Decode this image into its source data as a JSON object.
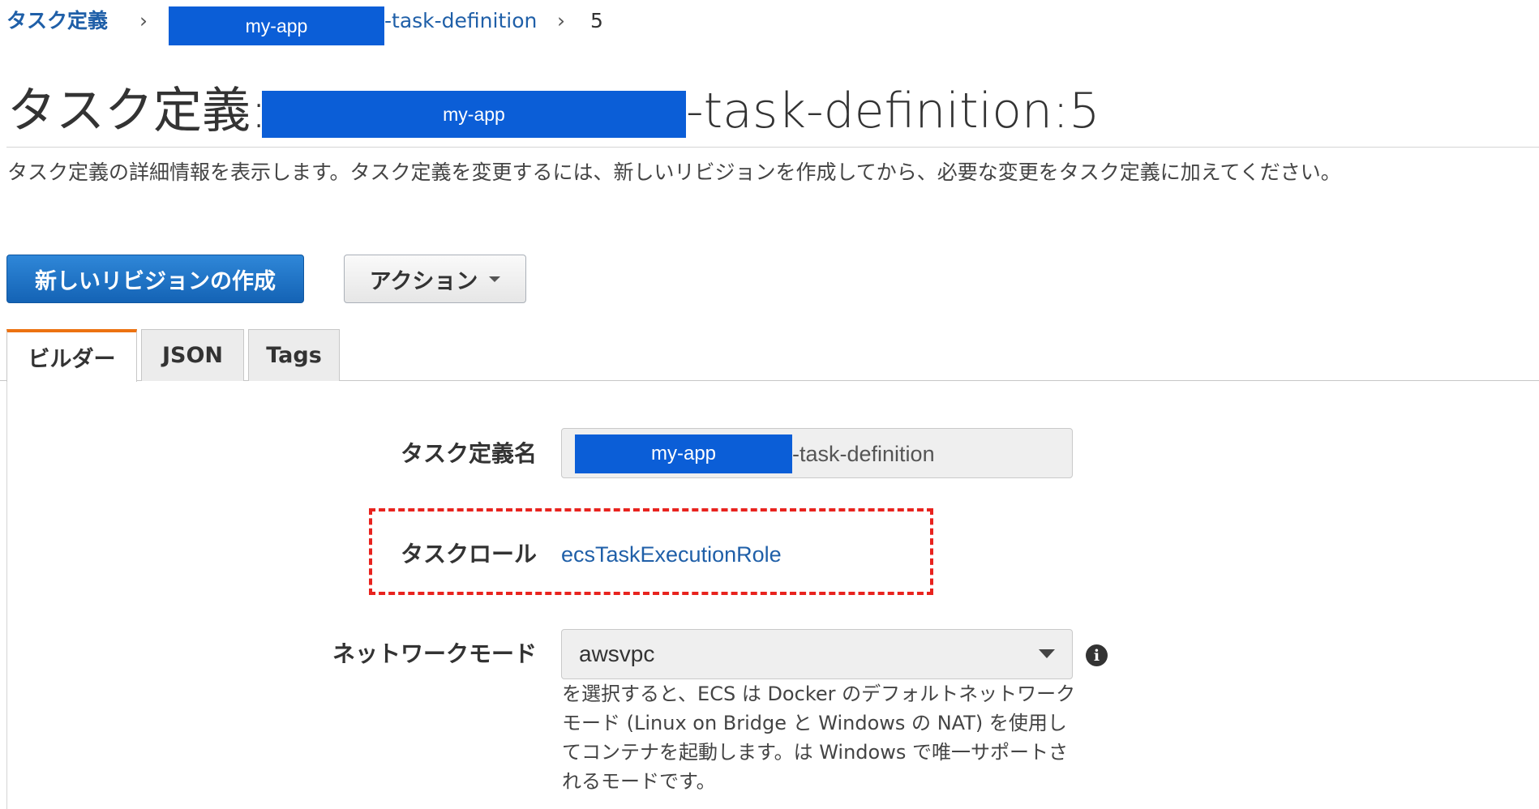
{
  "breadcrumb": {
    "root": "タスク定義",
    "redacted_name": "my-app",
    "definition_suffix": "-task-definition",
    "revision": "5",
    "separator": "›"
  },
  "title": {
    "prefix": "タスク定義: ",
    "redacted_name": "my-app",
    "suffix": "-task-definition:5"
  },
  "description": "タスク定義の詳細情報を表示します。タスク定義を変更するには、新しいリビジョンを作成してから、必要な変更をタスク定義に加えてください。",
  "toolbar": {
    "create_revision_label": "新しいリビジョンの作成",
    "actions_label": "アクション"
  },
  "tabs": [
    {
      "label": "ビルダー",
      "active": true
    },
    {
      "label": "JSON",
      "active": false
    },
    {
      "label": "Tags",
      "active": false
    }
  ],
  "form": {
    "task_def_name": {
      "label": "タスク定義名",
      "redacted_name": "my-app",
      "suffix": "-task-definition"
    },
    "task_role": {
      "label": "タスクロール",
      "value": "ecsTaskExecutionRole"
    },
    "network_mode": {
      "label": "ネットワークモード",
      "value": "awsvpc",
      "help": "を選択すると、ECS は Docker のデフォルトネットワークモード (Linux on Bridge と Windows の NAT) を使用してコンテナを起動します。は Windows で唯一サポートされるモードです。"
    }
  },
  "icons": {
    "info": "info-icon",
    "dropdown": "chevron-down-icon"
  },
  "colors": {
    "primary": "#1f6fc8",
    "link": "#1f5fa8",
    "redaction": "#0b5ed7",
    "active_tab_accent": "#ec7211",
    "highlight_box": "#e8231e"
  }
}
